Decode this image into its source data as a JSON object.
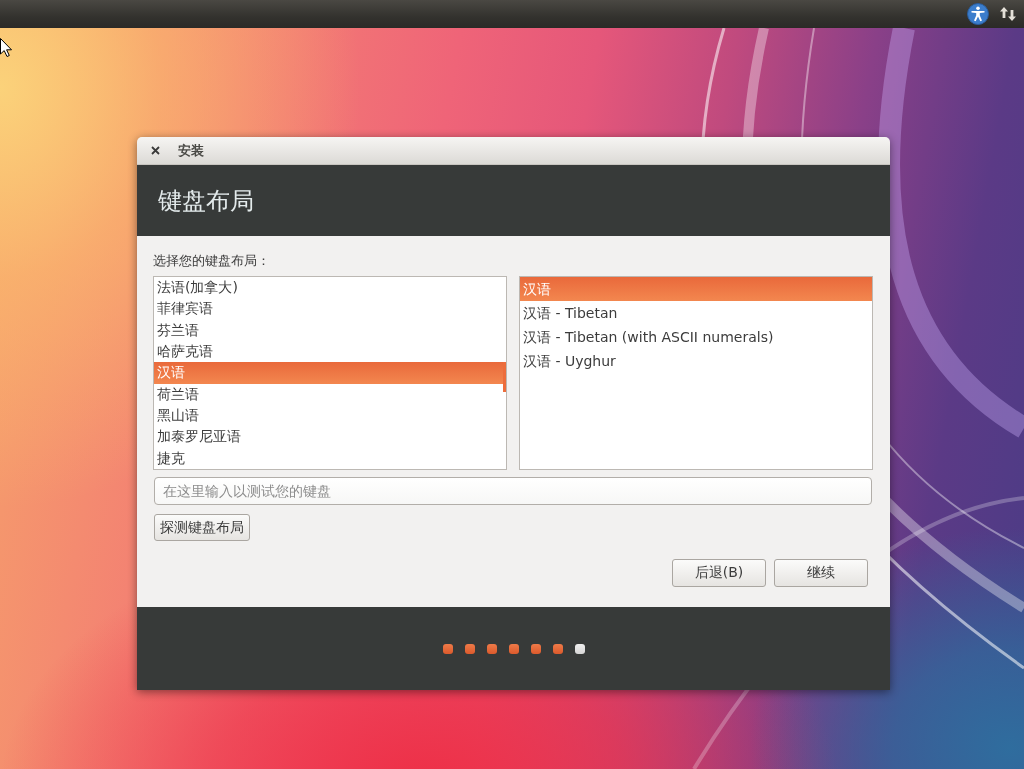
{
  "window": {
    "title": "安装"
  },
  "header": {
    "title": "键盘布局"
  },
  "layout_prompt": "选择您的键盘布局：",
  "layout_list": {
    "items": [
      {
        "label": "法语(加拿大)",
        "selected": false
      },
      {
        "label": "菲律宾语",
        "selected": false
      },
      {
        "label": "芬兰语",
        "selected": false
      },
      {
        "label": "哈萨克语",
        "selected": false
      },
      {
        "label": "汉语",
        "selected": true
      },
      {
        "label": "荷兰语",
        "selected": false
      },
      {
        "label": "黑山语",
        "selected": false
      },
      {
        "label": "加泰罗尼亚语",
        "selected": false
      },
      {
        "label": "捷克",
        "selected": false
      }
    ]
  },
  "variant_list": {
    "items": [
      {
        "label": "汉语",
        "selected": true
      },
      {
        "label": "汉语 - Tibetan",
        "selected": false
      },
      {
        "label": "汉语 - Tibetan (with ASCII numerals)",
        "selected": false
      },
      {
        "label": "汉语 - Uyghur",
        "selected": false
      }
    ]
  },
  "test_field": {
    "placeholder": "在这里输入以测试您的键盘"
  },
  "detect_button": {
    "label": "探测键盘布局"
  },
  "buttons": [
    {
      "label": "后退(B)"
    },
    {
      "label": "继续"
    }
  ],
  "progress_dots": [
    {
      "done": true
    },
    {
      "done": true
    },
    {
      "done": true
    },
    {
      "done": true
    },
    {
      "done": true
    },
    {
      "done": true
    },
    {
      "done": false
    }
  ]
}
